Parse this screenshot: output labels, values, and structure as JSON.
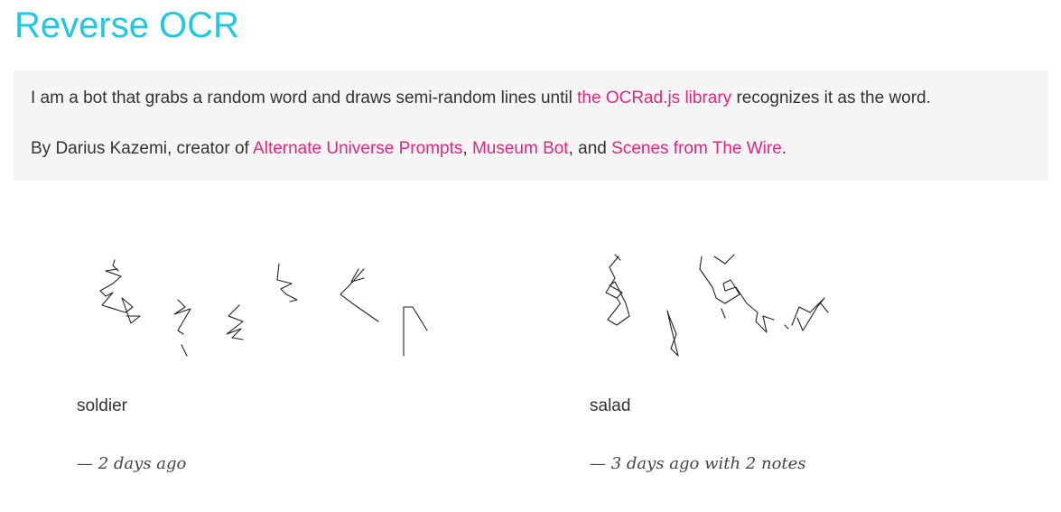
{
  "header": {
    "title": "Reverse OCR"
  },
  "description": {
    "line1": {
      "before": "I am a bot that grabs a random word and draws semi-random lines until ",
      "link": "the OCRad.js library",
      "after": " recognizes it as the word."
    },
    "line2": {
      "before": "By Darius Kazemi, creator of ",
      "link1": "Alternate Universe Prompts",
      "sep1": ", ",
      "link2": "Museum Bot",
      "sep2": ", and ",
      "link3": "Scenes from The Wire",
      "after": "."
    }
  },
  "colors": {
    "title": "#22c7e0",
    "link": "#e8247e",
    "panel": "#f5f5f5"
  },
  "posts": [
    {
      "word": "soldier",
      "time": "— 2 days ago",
      "notes": ""
    },
    {
      "word": "salad",
      "time": "— 3 days ago",
      "notes": " with 2 notes"
    }
  ]
}
